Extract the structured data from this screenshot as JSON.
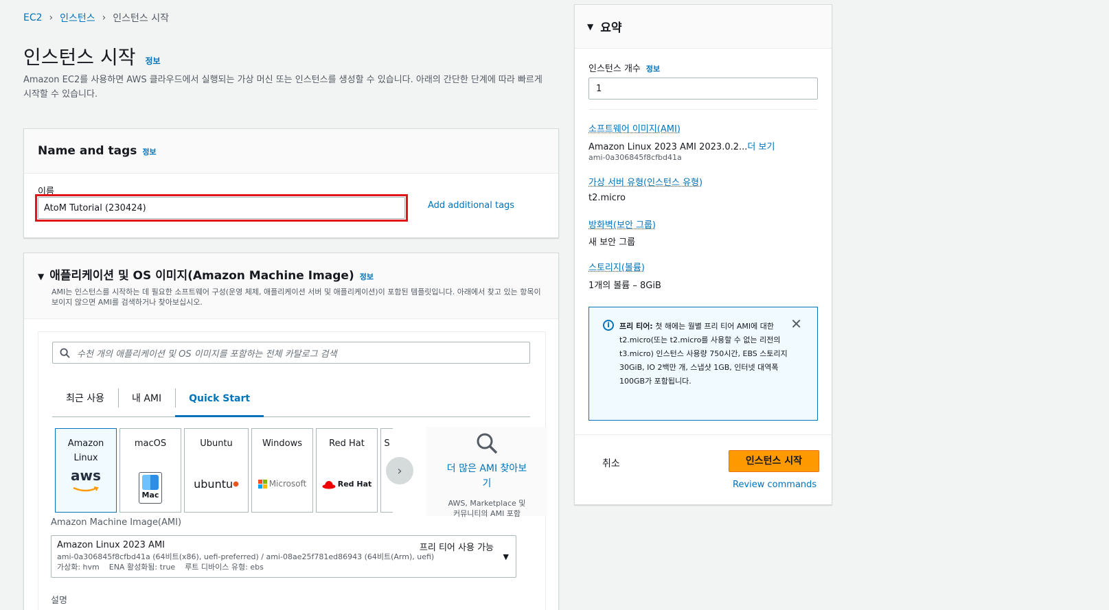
{
  "breadcrumb": [
    {
      "label": "EC2"
    },
    {
      "label": "인스턴스"
    },
    {
      "label": "인스턴스 시작"
    }
  ],
  "page": {
    "title": "인스턴스 시작",
    "info": "정보",
    "description": "Amazon EC2를 사용하면 AWS 클라우드에서 실행되는 가상 머신 또는 인스턴스를 생성할 수 있습니다. 아래의 간단한 단계에 따라 빠르게 시작할 수 있습니다."
  },
  "name_tags": {
    "title": "Name and tags",
    "info": "정보",
    "name_label": "이름",
    "name_value": "AtoM Tutorial (230424)",
    "add_tags": "Add additional tags"
  },
  "ami": {
    "title": "애플리케이션 및 OS 이미지(Amazon Machine Image)",
    "info": "정보",
    "description": "AMI는 인스턴스를 시작하는 데 필요한 소프트웨어 구성(운영 체제, 애플리케이션 서버 및 애플리케이션)이 포함된 템플릿입니다. 아래에서 찾고 있는 항목이 보이지 않으면 AMI를 검색하거나 찾아보십시오.",
    "search_placeholder": "수천 개의 애플리케이션 및 OS 이미지를 포함하는 전체 카탈로그 검색",
    "tabs": [
      {
        "label": "최근 사용"
      },
      {
        "label": "내 AMI"
      },
      {
        "label": "Quick Start"
      }
    ],
    "os_cards": [
      {
        "label": "Amazon Linux",
        "logo": "aws"
      },
      {
        "label": "macOS",
        "logo": "Mac"
      },
      {
        "label": "Ubuntu",
        "logo": "ubuntu"
      },
      {
        "label": "Windows",
        "logo": "Microsoft"
      },
      {
        "label": "Red Hat",
        "logo": "Red Hat"
      },
      {
        "label": "S",
        "logo": ""
      }
    ],
    "browse_more": "더 많은 AMI 찾아보기",
    "browse_more_sub": "AWS, Marketplace 및 커뮤니티의 AMI 포함",
    "ami_label": "Amazon Machine Image(AMI)",
    "selected": {
      "name": "Amazon Linux 2023 AMI",
      "badge": "프리 티어 사용 가능",
      "detail1": "ami-0a306845f8cfbd41a (64비트(x86), uefi-preferred) / ami-08ae25f781ed86943 (64비트(Arm), uefi)",
      "detail2": "가상화: hvm    ENA 활성화됨: true    루트 디바이스 유형: ebs"
    },
    "desc_label": "설명"
  },
  "summary": {
    "title": "요약",
    "count_label": "인스턴스 개수",
    "count_info": "정보",
    "count_value": "1",
    "ami_key": "소프트웨어 이미지(AMI)",
    "ami_value": "Amazon Linux 2023 AMI 2023.0.2...",
    "ami_more": "더 보기",
    "ami_id": "ami-0a306845f8cfbd41a",
    "type_key": "가상 서버 유형(인스턴스 유형)",
    "type_value": "t2.micro",
    "fw_key": "방화벽(보안 그룹)",
    "fw_value": "새 보안 그룹",
    "storage_key": "스토리지(볼륨)",
    "storage_value": "1개의 볼륨 – 8GiB",
    "free_tier_bold": "프리 티어:",
    "free_tier_text": "첫 해에는 월별 프리 티어 AMI에 대한 t2.micro(또는 t2.micro를 사용할 수 없는 리전의 t3.micro) 인스턴스 사용량 750시간, EBS 스토리지 30GiB, IO 2백만 개, 스냅샷 1GB, 인터넷 대역폭 100GB가 포함됩니다.",
    "cancel": "취소",
    "launch": "인스턴스 시작",
    "review": "Review commands"
  },
  "colors": {
    "accent": "#0073bb",
    "launch": "#ff9900",
    "highlight": "#e2141b"
  }
}
